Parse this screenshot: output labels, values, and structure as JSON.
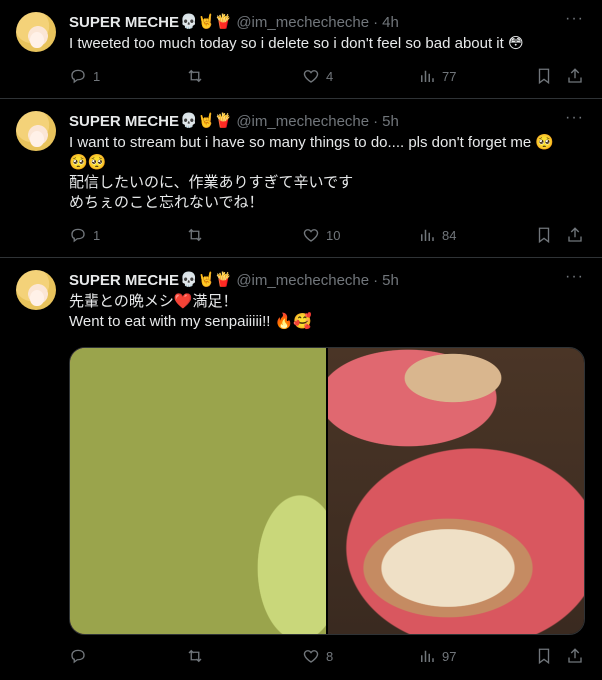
{
  "tweets": [
    {
      "display_name": "SUPER MECHE",
      "name_emojis": "💀🤘🍟",
      "handle": "@im_mechecheche",
      "time": "4h",
      "text_lines": [
        "I tweeted too much today so i delete so i don't feel so bad about it 😳"
      ],
      "replies": "1",
      "retweets": "",
      "likes": "4",
      "views": "77"
    },
    {
      "display_name": "SUPER MECHE",
      "name_emojis": "💀🤘🍟",
      "handle": "@im_mechecheche",
      "time": "5h",
      "text_lines": [
        "I want to stream but i have so many  things to do.... pls don't forget me 🥺",
        "🥺🥺",
        "配信したいのに、作業ありすぎて辛いです",
        "めちぇのこと忘れないでね！"
      ],
      "replies": "1",
      "retweets": "",
      "likes": "10",
      "views": "84"
    },
    {
      "display_name": "SUPER MECHE",
      "name_emojis": "💀🤘🍟",
      "handle": "@im_mechecheche",
      "time": "5h",
      "text_lines": [
        "先輩との晩メシ❤️満足！",
        "Went to eat with my senpaiiiii!! 🔥🥰"
      ],
      "replies": "",
      "retweets": "",
      "likes": "8",
      "views": "97"
    }
  ],
  "separator": "·",
  "more_glyph": "···",
  "icons": {
    "reply": "reply-icon",
    "retweet": "retweet-icon",
    "like": "heart-icon",
    "views": "views-icon",
    "bookmark": "bookmark-icon",
    "share": "share-icon"
  },
  "colors": {
    "background": "#000000",
    "text": "#e7e9ea",
    "muted": "#71767b",
    "divider": "#2f3336"
  }
}
